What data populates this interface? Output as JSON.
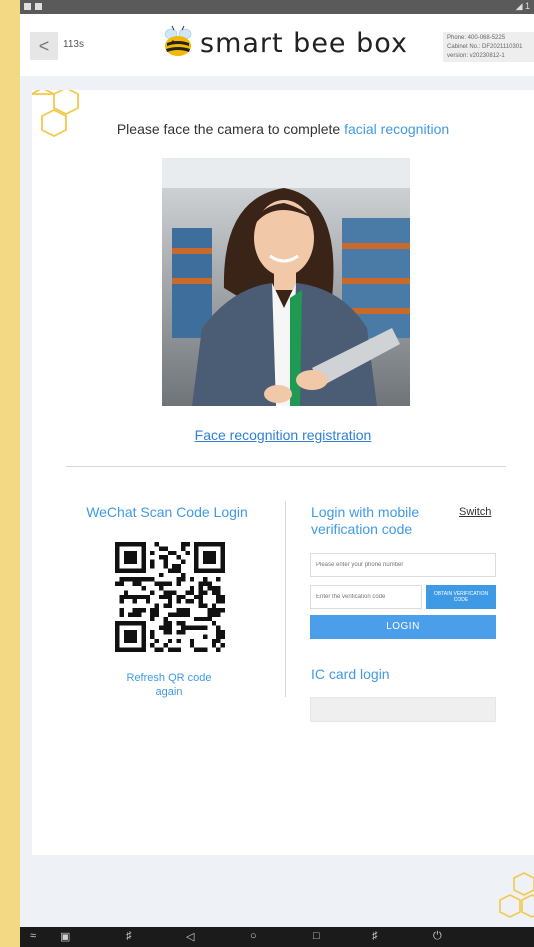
{
  "header": {
    "back_glyph": "<",
    "timer": "113s",
    "brand": "smart bee box",
    "info": {
      "phone": "Phone: 400-068-5225",
      "cabinet": "Cabinet No.: DF2021110301",
      "version": "version: v20230812-1"
    }
  },
  "face": {
    "prompt_prefix": "Please face the camera to complete",
    "prompt_highlight": "facial recognition",
    "registration_link": "Face recognition registration"
  },
  "wechat": {
    "title": "WeChat Scan Code Login",
    "refresh_line1": "Refresh QR code",
    "refresh_line2": "again"
  },
  "mobile": {
    "title_line1": "Login with mobile",
    "title_line2": "verification code",
    "switch_label": "Switch",
    "phone_placeholder": "Please enter your phone number",
    "code_placeholder": "Enter the verification code",
    "obtain_label": "OBTAIN VERIFICATION CODE",
    "login_label": "LOGIN"
  },
  "ic": {
    "title": "IC card login"
  },
  "colors": {
    "accent": "#3f9ae6",
    "frame": "#f4d985",
    "hex_outline": "#f2c94c"
  },
  "icons": {
    "status_left": [
      "notification-icon",
      "notification-icon"
    ],
    "status_right": [
      "signal-icon"
    ],
    "navbar": [
      "wifi-icon",
      "screenshot-icon",
      "volume-down-icon",
      "back-icon",
      "home-icon",
      "recents-icon",
      "volume-up-icon",
      "power-icon"
    ]
  }
}
